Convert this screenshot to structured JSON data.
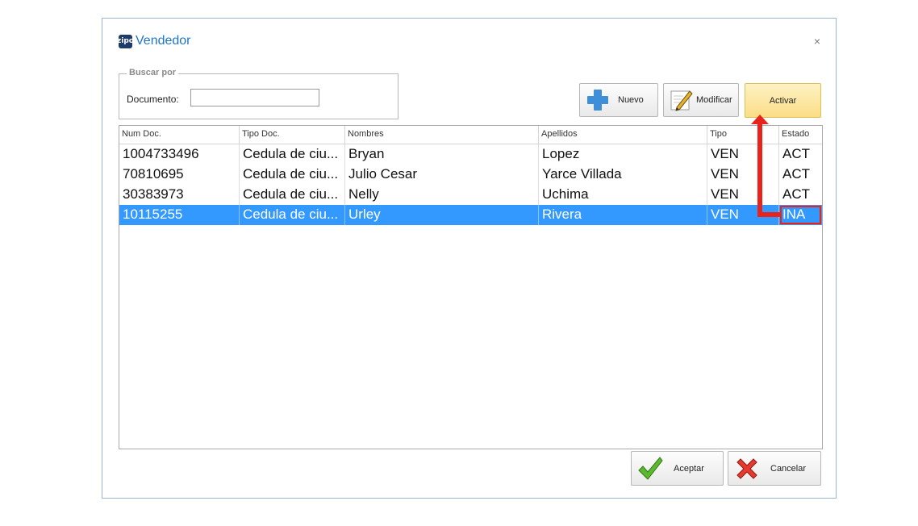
{
  "window": {
    "app_icon_text": "zipo",
    "title": "Vendedor",
    "close_glyph": "×"
  },
  "search": {
    "legend": "Buscar por",
    "document_label": "Documento:",
    "document_value": "",
    "document_placeholder": ""
  },
  "toolbar": {
    "new_label": "Nuevo",
    "modify_label": "Modificar",
    "activate_label": "Activar"
  },
  "grid": {
    "columns": [
      "Num Doc.",
      "Tipo Doc.",
      "Nombres",
      "Apellidos",
      "Tipo",
      "Estado"
    ],
    "rows": [
      {
        "num_doc": "1004733496",
        "tipo_doc": "Cedula de ciu...",
        "nombres": "Bryan",
        "apellidos": "Lopez",
        "tipo": "VEN",
        "estado": "ACT"
      },
      {
        "num_doc": "70810695",
        "tipo_doc": "Cedula de ciu...",
        "nombres": "Julio Cesar",
        "apellidos": "Yarce Villada",
        "tipo": "VEN",
        "estado": "ACT"
      },
      {
        "num_doc": "30383973",
        "tipo_doc": "Cedula de ciu...",
        "nombres": "Nelly",
        "apellidos": "Uchima",
        "tipo": "VEN",
        "estado": "ACT"
      },
      {
        "num_doc": "10115255",
        "tipo_doc": "Cedula de ciu...",
        "nombres": "Urley",
        "apellidos": "Rivera",
        "tipo": "VEN",
        "estado": "INA"
      }
    ],
    "selected_row_index": 3
  },
  "footer": {
    "accept_label": "Aceptar",
    "cancel_label": "Cancelar"
  },
  "icons": {
    "app": "app-logo-icon",
    "new": "plus-icon",
    "modify": "pencil-icon",
    "accept": "checkmark-icon",
    "cancel": "red-x-icon",
    "annotation": "red-arrow-icon"
  },
  "colors": {
    "title": "#1e75c8",
    "selection": "#3399ff",
    "activate_button": "#fbdd86",
    "annotation": "#e8231b"
  }
}
